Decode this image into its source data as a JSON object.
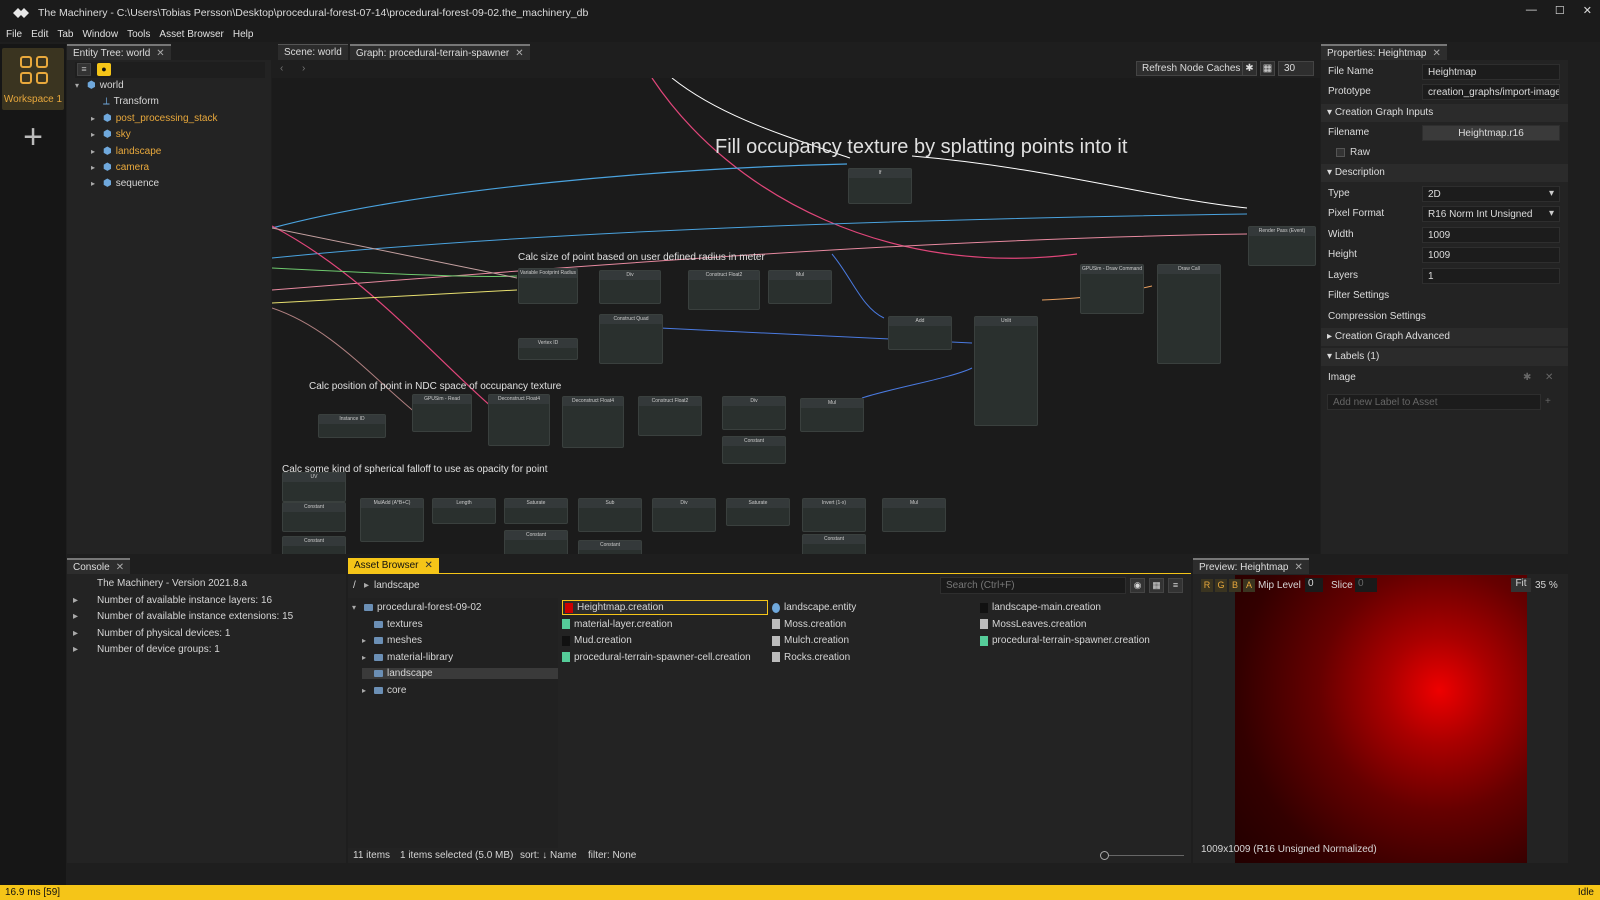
{
  "window": {
    "title": "The Machinery - C:\\Users\\Tobias Persson\\Desktop\\procedural-forest-07-14\\procedural-forest-09-02.the_machinery_db",
    "controls": [
      "—",
      "☐",
      "✕"
    ]
  },
  "menu": [
    "File",
    "Edit",
    "Tab",
    "Window",
    "Tools",
    "Asset Browser",
    "Help"
  ],
  "workspace": {
    "label": "Workspace 1"
  },
  "entity_tree": {
    "tab": "Entity Tree: world",
    "items": [
      {
        "label": "world",
        "depth": 0,
        "arrow": "▾",
        "icon": "cube"
      },
      {
        "label": "Transform",
        "depth": 1,
        "arrow": "",
        "icon": "transform"
      },
      {
        "label": "post_processing_stack",
        "depth": 1,
        "arrow": "▸",
        "icon": "cube",
        "highlight": true
      },
      {
        "label": "sky",
        "depth": 1,
        "arrow": "▸",
        "icon": "cube",
        "highlight": true
      },
      {
        "label": "landscape",
        "depth": 1,
        "arrow": "▸",
        "icon": "cube",
        "highlight": true
      },
      {
        "label": "camera",
        "depth": 1,
        "arrow": "▸",
        "icon": "cube",
        "highlight": true
      },
      {
        "label": "sequence",
        "depth": 1,
        "arrow": "▸",
        "icon": "cube",
        "highlight": false
      }
    ]
  },
  "graph": {
    "tabs": [
      "Scene: world",
      "Graph: procedural-terrain-spawner"
    ],
    "refresh_label": "Refresh Node Caches",
    "zoom_value": "30",
    "comments": [
      "Fill occupancy texture by splatting points into it",
      "Calc size of point based on user defined radius in meter",
      "Calc position of point in NDC space of occupancy texture",
      "Calc some kind of spherical falloff to use as opacity for point"
    ],
    "nodes": [
      "Variable Footprint Radius",
      "Div",
      "Construct Float2",
      "Mul",
      "Vertex ID",
      "Construct Quad",
      "Add",
      "Unlit",
      "GPUSim - Draw Command",
      "Draw Call",
      "Render Pass (Event)",
      "If",
      "Instance ID",
      "GPUSim - Read",
      "Deconstruct Float4",
      "Deconstruct Float4",
      "Construct Float2",
      "Div",
      "Mul",
      "Constant",
      "UV",
      "Constant",
      "Constant",
      "MulAdd (A*B+C)",
      "Length",
      "Saturate",
      "Constant",
      "Sub",
      "Constant",
      "Div",
      "Saturate",
      "Invert (1-x)",
      "Constant",
      "Mul"
    ]
  },
  "properties": {
    "tab": "Properties: Heightmap",
    "file_name_label": "File Name",
    "file_name": "Heightmap",
    "prototype_label": "Prototype",
    "prototype": "creation_graphs/import-image",
    "sec_inputs": "Creation Graph Inputs",
    "filename_label": "Filename",
    "filename": "Heightmap.r16",
    "raw_label": "Raw",
    "sec_description": "Description",
    "type_label": "Type",
    "type": "2D",
    "pixel_format_label": "Pixel Format",
    "pixel_format": "R16 Norm Int Unsigned",
    "width_label": "Width",
    "width": "1009",
    "height_label": "Height",
    "height": "1009",
    "layers_label": "Layers",
    "layers": "1",
    "filter_settings": "Filter Settings",
    "compression_settings": "Compression Settings",
    "sec_advanced": "Creation Graph Advanced",
    "sec_labels": "Labels (1)",
    "label_image": "Image",
    "add_label_placeholder": "Add new Label to Asset"
  },
  "console": {
    "tab": "Console",
    "lines": [
      {
        "arrow": "",
        "text": "The Machinery - Version 2021.8.a"
      },
      {
        "arrow": "▸",
        "text": "Number of available instance layers: 16"
      },
      {
        "arrow": "▸",
        "text": "Number of available instance extensions: 15"
      },
      {
        "arrow": "▸",
        "text": "Number of physical devices: 1"
      },
      {
        "arrow": "▸",
        "text": "Number of device groups: 1"
      }
    ]
  },
  "asset_browser": {
    "tab": "Asset Browser",
    "path_root": "/",
    "path_current": "landscape",
    "search_placeholder": "Search (Ctrl+F)",
    "folders": [
      {
        "label": "procedural-forest-09-02",
        "depth": 0,
        "arrow": "▾"
      },
      {
        "label": "textures",
        "depth": 1,
        "arrow": ""
      },
      {
        "label": "meshes",
        "depth": 1,
        "arrow": "▸"
      },
      {
        "label": "material-library",
        "depth": 1,
        "arrow": "▸"
      },
      {
        "label": "landscape",
        "depth": 1,
        "arrow": "",
        "selected": true
      },
      {
        "label": "core",
        "depth": 1,
        "arrow": "▸"
      }
    ],
    "files": [
      {
        "label": "Heightmap.creation",
        "icon": "red",
        "selected": true
      },
      {
        "label": "material-layer.creation",
        "icon": "green"
      },
      {
        "label": "Mud.creation",
        "icon": "dark"
      },
      {
        "label": "procedural-terrain-spawner-cell.creation",
        "icon": "green"
      },
      {
        "label": "landscape.entity",
        "icon": "cube"
      },
      {
        "label": "Moss.creation",
        "icon": "noise"
      },
      {
        "label": "Mulch.creation",
        "icon": "noise"
      },
      {
        "label": "Rocks.creation",
        "icon": "noise"
      },
      {
        "label": "landscape-main.creation",
        "icon": "dark"
      },
      {
        "label": "MossLeaves.creation",
        "icon": "noise"
      },
      {
        "label": "procedural-terrain-spawner.creation",
        "icon": "green"
      }
    ],
    "status": {
      "items": "11 items",
      "selected": "1 items selected (5.0 MB)",
      "sort": "sort: ↓ Name",
      "filter": "filter: None"
    }
  },
  "preview": {
    "tab": "Preview: Heightmap",
    "channels": [
      "R",
      "G",
      "B",
      "A"
    ],
    "mip_label": "Mip Level",
    "mip_value": "0",
    "slice_label": "Slice",
    "slice_value": "0",
    "fit_label": "Fit",
    "zoom": "35 %",
    "info": "1009x1009 (R16 Unsigned Normalized)"
  },
  "statusbar": {
    "left": "16.9 ms [59]",
    "right": "Idle"
  }
}
